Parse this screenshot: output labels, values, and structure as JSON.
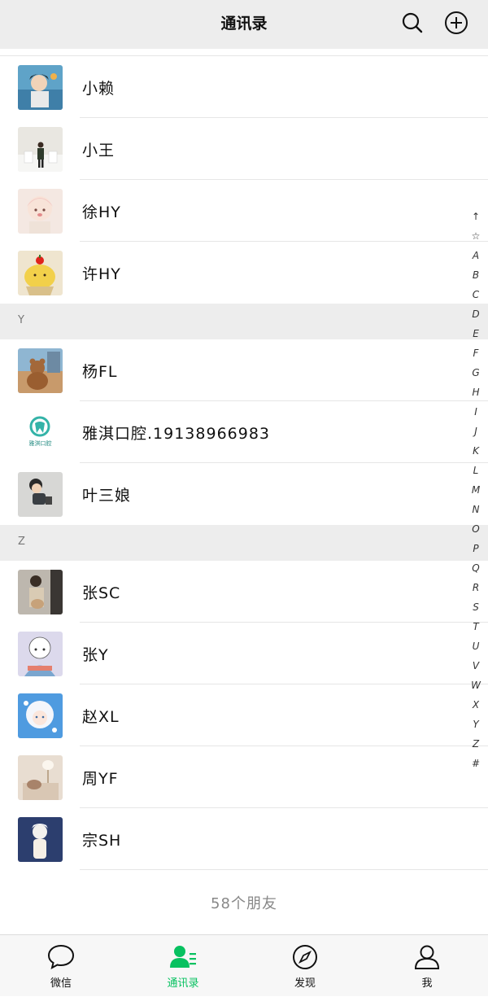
{
  "header": {
    "title": "通讯录"
  },
  "contacts_top": [
    {
      "name": "小赖"
    },
    {
      "name": "小王"
    },
    {
      "name": "徐HY"
    },
    {
      "name": "许HY"
    }
  ],
  "section_y": {
    "letter": "Y"
  },
  "contacts_y": [
    {
      "name": "杨FL"
    },
    {
      "name": "雅淇口腔.19138966983",
      "avatar_text": "雅淇口腔"
    },
    {
      "name": "叶三娘"
    }
  ],
  "section_z": {
    "letter": "Z"
  },
  "contacts_z": [
    {
      "name": "张SC"
    },
    {
      "name": "张Y"
    },
    {
      "name": "赵XL"
    },
    {
      "name": "周YF"
    },
    {
      "name": "宗SH"
    }
  ],
  "footer": {
    "friend_count": "58个朋友"
  },
  "index_letters": [
    "↑",
    "☆",
    "A",
    "B",
    "C",
    "D",
    "E",
    "F",
    "G",
    "H",
    "I",
    "J",
    "K",
    "L",
    "M",
    "N",
    "O",
    "P",
    "Q",
    "R",
    "S",
    "T",
    "U",
    "V",
    "W",
    "X",
    "Y",
    "Z",
    "#"
  ],
  "tabs": [
    {
      "label": "微信",
      "icon": "chat-bubble-icon"
    },
    {
      "label": "通讯录",
      "icon": "contacts-icon",
      "active": true
    },
    {
      "label": "发现",
      "icon": "compass-icon"
    },
    {
      "label": "我",
      "icon": "person-icon"
    }
  ],
  "colors": {
    "accent": "#07c160",
    "header_bg": "#ededed",
    "section_bg": "#ededed"
  }
}
